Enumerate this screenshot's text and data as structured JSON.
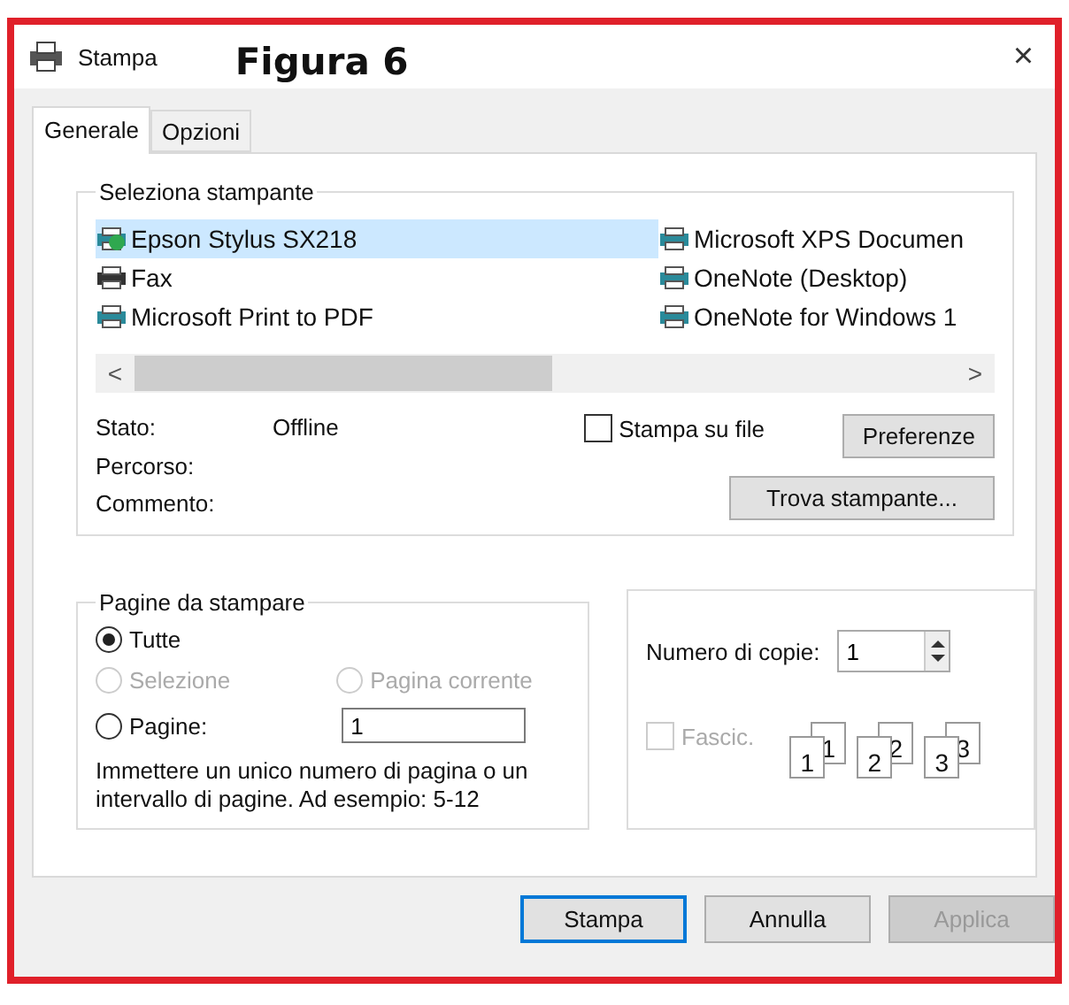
{
  "window": {
    "title": "Stampa",
    "caption": "Figura 6",
    "close": "×"
  },
  "tabs": [
    {
      "label": "Generale",
      "selected": true
    },
    {
      "label": "Opzioni",
      "selected": false
    }
  ],
  "printer_group": {
    "title": "Seleziona stampante",
    "printers": [
      {
        "name": "Epson Stylus SX218",
        "kind": "default",
        "selected": true
      },
      {
        "name": "Fax",
        "kind": "fax",
        "selected": false
      },
      {
        "name": "Microsoft Print to PDF",
        "kind": "printer",
        "selected": false
      },
      {
        "name": "Microsoft XPS Documen",
        "kind": "printer",
        "selected": false
      },
      {
        "name": "OneNote (Desktop)",
        "kind": "printer",
        "selected": false
      },
      {
        "name": "OneNote for Windows 1",
        "kind": "printer",
        "selected": false
      }
    ],
    "scroll_left": "<",
    "scroll_right": ">",
    "info": [
      {
        "label": "Stato:",
        "value": "Offline"
      },
      {
        "label": "Percorso:"
      },
      {
        "label": "Commento:"
      }
    ],
    "print_to_file": {
      "label": "Stampa su file",
      "checked": false
    },
    "preferences": "Preferenze",
    "find_printer": "Trova stampante..."
  },
  "pages_group": {
    "title": "Pagine da stampare",
    "options": [
      {
        "label": "Tutte",
        "selected": true,
        "disabled": false
      },
      {
        "label": "Selezione",
        "selected": false,
        "disabled": true
      },
      {
        "label": "Pagina corrente",
        "selected": false,
        "disabled": true
      },
      {
        "label": "Pagine:",
        "selected": false,
        "disabled": false
      }
    ],
    "pages_value": "1",
    "hint": "Immettere un unico numero di pagina o un intervallo di pagine. Ad esempio: 5-12"
  },
  "copies_group": {
    "label": "Numero di copie:",
    "value": "1",
    "collate": {
      "label": "Fascic.",
      "checked": false,
      "disabled": true
    },
    "collate_pages": [
      [
        "1",
        "1"
      ],
      [
        "2",
        "2"
      ],
      [
        "3",
        "3"
      ]
    ]
  },
  "buttons": [
    {
      "label": "Stampa",
      "default": true,
      "disabled": false
    },
    {
      "label": "Annulla",
      "default": false,
      "disabled": false
    },
    {
      "label": "Applica",
      "default": false,
      "disabled": true
    }
  ]
}
